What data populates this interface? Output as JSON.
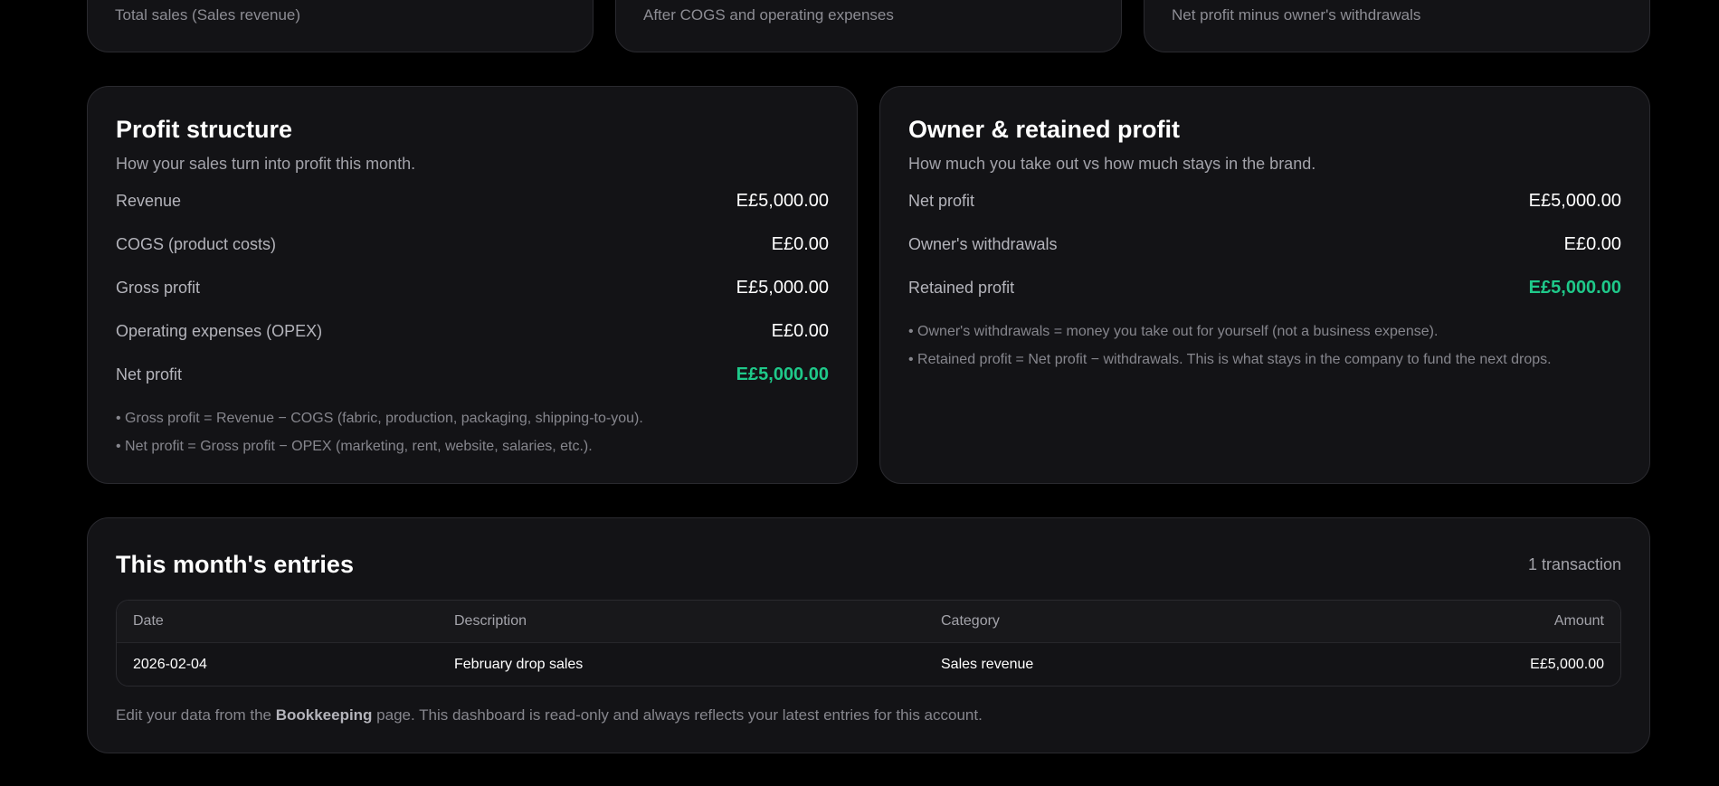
{
  "kpis": [
    {
      "subtitle": "Total sales (Sales revenue)"
    },
    {
      "subtitle": "After COGS and operating expenses"
    },
    {
      "subtitle": "Net profit minus owner's withdrawals"
    }
  ],
  "profit_structure": {
    "title": "Profit structure",
    "subtitle": "How your sales turn into profit this month.",
    "rows": [
      {
        "label": "Revenue",
        "value": "E£5,000.00"
      },
      {
        "label": "COGS (product costs)",
        "value": "E£0.00"
      },
      {
        "label": "Gross profit",
        "value": "E£5,000.00"
      },
      {
        "label": "Operating expenses (OPEX)",
        "value": "E£0.00"
      },
      {
        "label": "Net profit",
        "value": "E£5,000.00"
      }
    ],
    "notes": [
      "• Gross profit = Revenue − COGS (fabric, production, packaging, shipping-to-you).",
      "• Net profit = Gross profit − OPEX (marketing, rent, website, salaries, etc.)."
    ]
  },
  "owner_retained": {
    "title": "Owner & retained profit",
    "subtitle": "How much you take out vs how much stays in the brand.",
    "rows": [
      {
        "label": "Net profit",
        "value": "E£5,000.00"
      },
      {
        "label": "Owner's withdrawals",
        "value": "E£0.00"
      },
      {
        "label": "Retained profit",
        "value": "E£5,000.00"
      }
    ],
    "notes": [
      "• Owner's withdrawals = money you take out for yourself (not a business expense).",
      "• Retained profit = Net profit − withdrawals. This is what stays in the company to fund the next drops."
    ]
  },
  "entries": {
    "title": "This month's entries",
    "count": "1 transaction",
    "columns": [
      "Date",
      "Description",
      "Category",
      "Amount"
    ],
    "rows": [
      {
        "date": "2026-02-04",
        "description": "February drop sales",
        "category": "Sales revenue",
        "amount": "E£5,000.00"
      }
    ],
    "footer_prefix": "Edit your data from the ",
    "footer_link": "Bookkeeping",
    "footer_suffix": " page. This dashboard is read-only and always reflects your latest entries for this account."
  },
  "colors": {
    "background": "#000000",
    "card": "#131316",
    "positive": "#1fc98a"
  }
}
